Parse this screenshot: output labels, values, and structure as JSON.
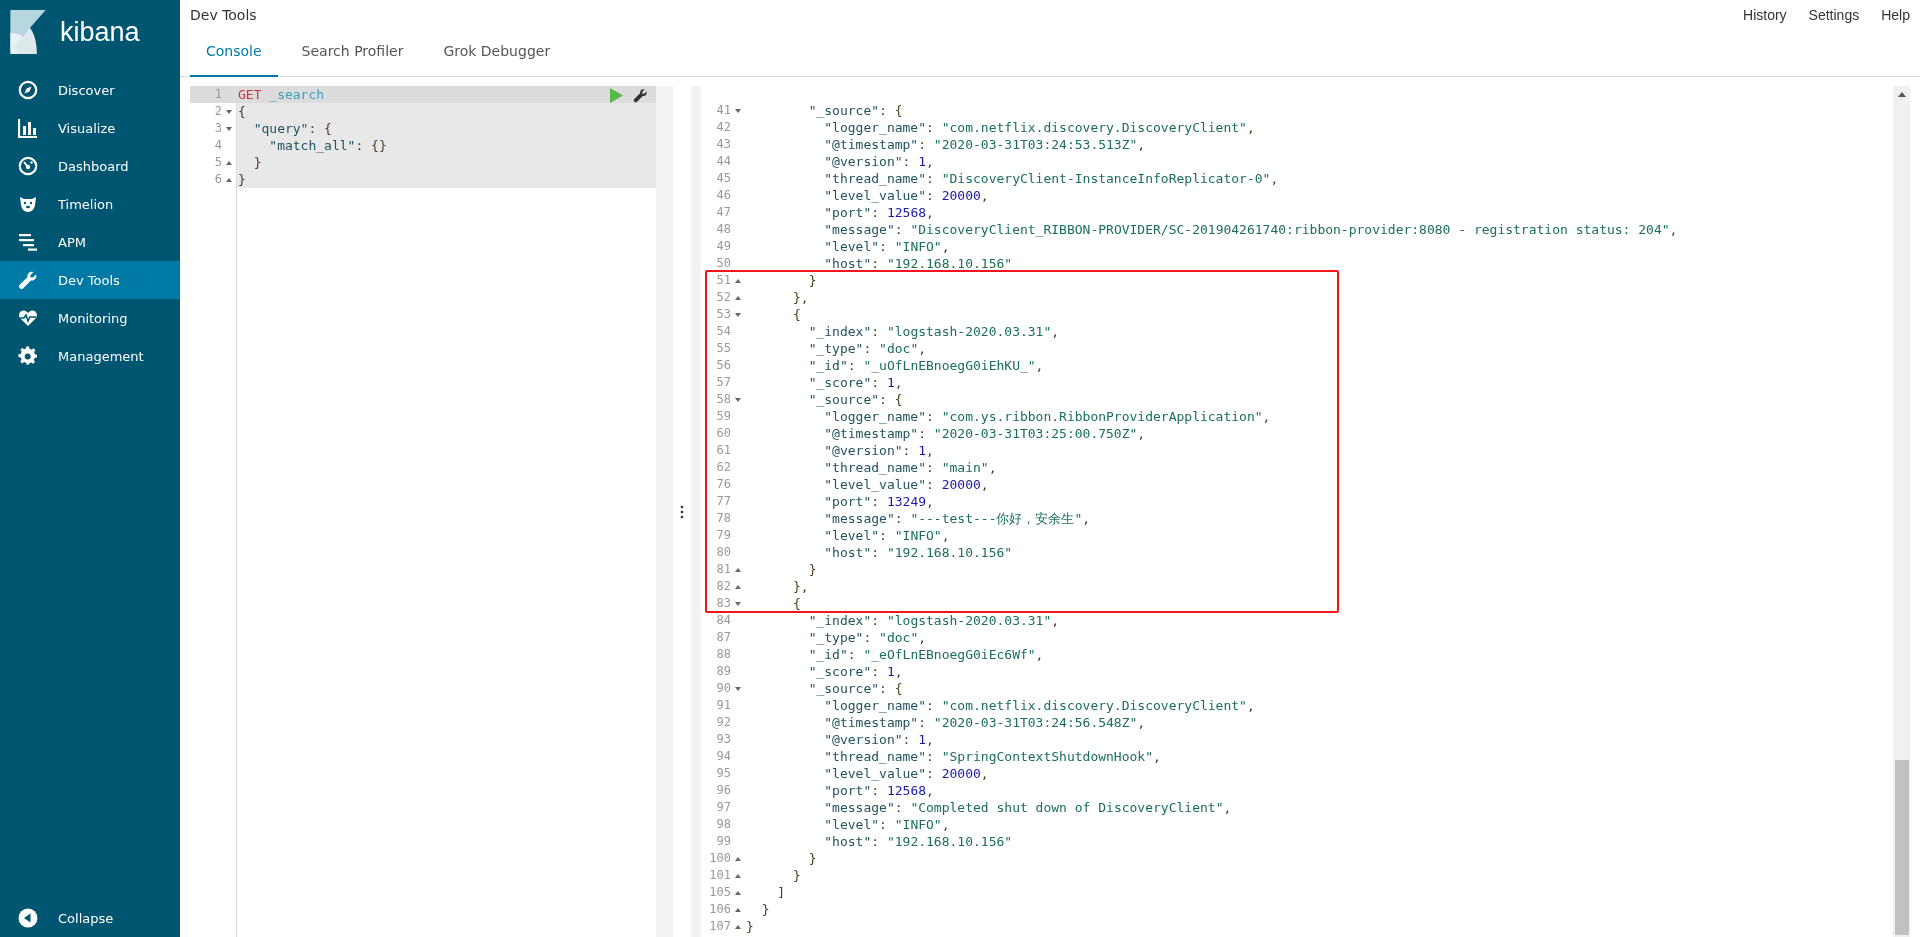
{
  "sidebar": {
    "logo": "kibana",
    "items": [
      {
        "label": "Discover",
        "selected": false
      },
      {
        "label": "Visualize",
        "selected": false
      },
      {
        "label": "Dashboard",
        "selected": false
      },
      {
        "label": "Timelion",
        "selected": false
      },
      {
        "label": "APM",
        "selected": false
      },
      {
        "label": "Dev Tools",
        "selected": true
      },
      {
        "label": "Monitoring",
        "selected": false
      },
      {
        "label": "Management",
        "selected": false
      }
    ],
    "collapse": "Collapse"
  },
  "header": {
    "title": "Dev Tools",
    "links": [
      "History",
      "Settings",
      "Help"
    ]
  },
  "tabs": [
    {
      "label": "Console",
      "selected": true
    },
    {
      "label": "Search Profiler",
      "selected": false
    },
    {
      "label": "Grok Debugger",
      "selected": false
    }
  ],
  "request_editor": {
    "lines": [
      {
        "num": "1",
        "text": "GET _search",
        "kind": "plain"
      },
      {
        "num": "2",
        "text": "{",
        "kind": "fold_start"
      },
      {
        "num": "3",
        "text": "  \"query\": {",
        "kind": "fold_start"
      },
      {
        "num": "4",
        "text": "    \"match_all\": {}",
        "kind": "plain"
      },
      {
        "num": "5",
        "text": "  }",
        "kind": "fold_end"
      },
      {
        "num": "6",
        "text": "}",
        "kind": "fold_end"
      }
    ]
  },
  "response_editor": {
    "blocks": [
      {
        "highlighted": false,
        "lines": [
          {
            "num": "41",
            "text": "        \"_source\": {",
            "kind": "fold_start"
          },
          {
            "num": "42",
            "text": "          \"logger_name\": \"com.netflix.discovery.DiscoveryClient\",",
            "kind": "plain"
          },
          {
            "num": "43",
            "text": "          \"@timestamp\": \"2020-03-31T03:24:53.513Z\",",
            "kind": "plain"
          },
          {
            "num": "44",
            "text": "          \"@version\": 1,",
            "kind": "plain"
          },
          {
            "num": "45",
            "text": "          \"thread_name\": \"DiscoveryClient-InstanceInfoReplicator-0\",",
            "kind": "plain"
          },
          {
            "num": "46",
            "text": "          \"level_value\": 20000,",
            "kind": "plain"
          },
          {
            "num": "47",
            "text": "          \"port\": 12568,",
            "kind": "plain"
          },
          {
            "num": "48",
            "text": "          \"message\": \"DiscoveryClient_RIBBON-PROVIDER/SC-201904261740:ribbon-provider:8080 - registration status: 204\",",
            "kind": "plain"
          },
          {
            "num": "49",
            "text": "          \"level\": \"INFO\",",
            "kind": "plain"
          },
          {
            "num": "50",
            "text": "          \"host\": \"192.168.10.156\"",
            "kind": "plain"
          }
        ]
      },
      {
        "highlighted": true,
        "lines": [
          {
            "num": "51",
            "text": "        }",
            "kind": "fold_end"
          },
          {
            "num": "52",
            "text": "      },",
            "kind": "fold_end"
          },
          {
            "num": "53",
            "text": "      {",
            "kind": "fold_start"
          },
          {
            "num": "54",
            "text": "        \"_index\": \"logstash-2020.03.31\",",
            "kind": "plain"
          },
          {
            "num": "55",
            "text": "        \"_type\": \"doc\",",
            "kind": "plain"
          },
          {
            "num": "56",
            "text": "        \"_id\": \"_uOfLnEBnoegG0iEhKU_\",",
            "kind": "plain"
          },
          {
            "num": "57",
            "text": "        \"_score\": 1,",
            "kind": "plain"
          },
          {
            "num": "58",
            "text": "        \"_source\": {",
            "kind": "fold_start"
          },
          {
            "num": "59",
            "text": "          \"logger_name\": \"com.ys.ribbon.RibbonProviderApplication\",",
            "kind": "plain"
          },
          {
            "num": "60",
            "text": "          \"@timestamp\": \"2020-03-31T03:25:00.750Z\",",
            "kind": "plain"
          },
          {
            "num": "61",
            "text": "          \"@version\": 1,",
            "kind": "plain"
          },
          {
            "num": "62",
            "text": "          \"thread_name\": \"main\",",
            "kind": "plain"
          },
          {
            "num": "76",
            "text": "          \"level_value\": 20000,",
            "kind": "plain"
          },
          {
            "num": "77",
            "text": "          \"port\": 13249,",
            "kind": "plain"
          },
          {
            "num": "78",
            "text": "          \"message\": \"---test---你好，安余生\",",
            "kind": "plain"
          },
          {
            "num": "79",
            "text": "          \"level\": \"INFO\",",
            "kind": "plain"
          },
          {
            "num": "80",
            "text": "          \"host\": \"192.168.10.156\"",
            "kind": "plain"
          },
          {
            "num": "81",
            "text": "        }",
            "kind": "fold_end"
          },
          {
            "num": "82",
            "text": "      },",
            "kind": "fold_end"
          },
          {
            "num": "83",
            "text": "      {",
            "kind": "fold_start"
          }
        ]
      },
      {
        "highlighted": false,
        "lines": [
          {
            "num": "84",
            "text": "        \"_index\": \"logstash-2020.03.31\",",
            "kind": "plain"
          },
          {
            "num": "87",
            "text": "        \"_type\": \"doc\",",
            "kind": "plain"
          },
          {
            "num": "88",
            "text": "        \"_id\": \"_eOfLnEBnoegG0iEc6Wf\",",
            "kind": "plain"
          },
          {
            "num": "89",
            "text": "        \"_score\": 1,",
            "kind": "plain"
          },
          {
            "num": "90",
            "text": "        \"_source\": {",
            "kind": "fold_start"
          },
          {
            "num": "91",
            "text": "          \"logger_name\": \"com.netflix.discovery.DiscoveryClient\",",
            "kind": "plain"
          },
          {
            "num": "92",
            "text": "          \"@timestamp\": \"2020-03-31T03:24:56.548Z\",",
            "kind": "plain"
          },
          {
            "num": "93",
            "text": "          \"@version\": 1,",
            "kind": "plain"
          },
          {
            "num": "94",
            "text": "          \"thread_name\": \"SpringContextShutdownHook\",",
            "kind": "plain"
          },
          {
            "num": "95",
            "text": "          \"level_value\": 20000,",
            "kind": "plain"
          },
          {
            "num": "96",
            "text": "          \"port\": 12568,",
            "kind": "plain"
          },
          {
            "num": "97",
            "text": "          \"message\": \"Completed shut down of DiscoveryClient\",",
            "kind": "plain"
          },
          {
            "num": "98",
            "text": "          \"level\": \"INFO\",",
            "kind": "plain"
          },
          {
            "num": "99",
            "text": "          \"host\": \"192.168.10.156\"",
            "kind": "plain"
          },
          {
            "num": "100",
            "text": "        }",
            "kind": "fold_end"
          },
          {
            "num": "101",
            "text": "      }",
            "kind": "fold_end"
          },
          {
            "num": "105",
            "text": "    ]",
            "kind": "fold_end"
          },
          {
            "num": "106",
            "text": "  }",
            "kind": "fold_end"
          },
          {
            "num": "107",
            "text": "}",
            "kind": "fold_end"
          }
        ]
      }
    ]
  }
}
